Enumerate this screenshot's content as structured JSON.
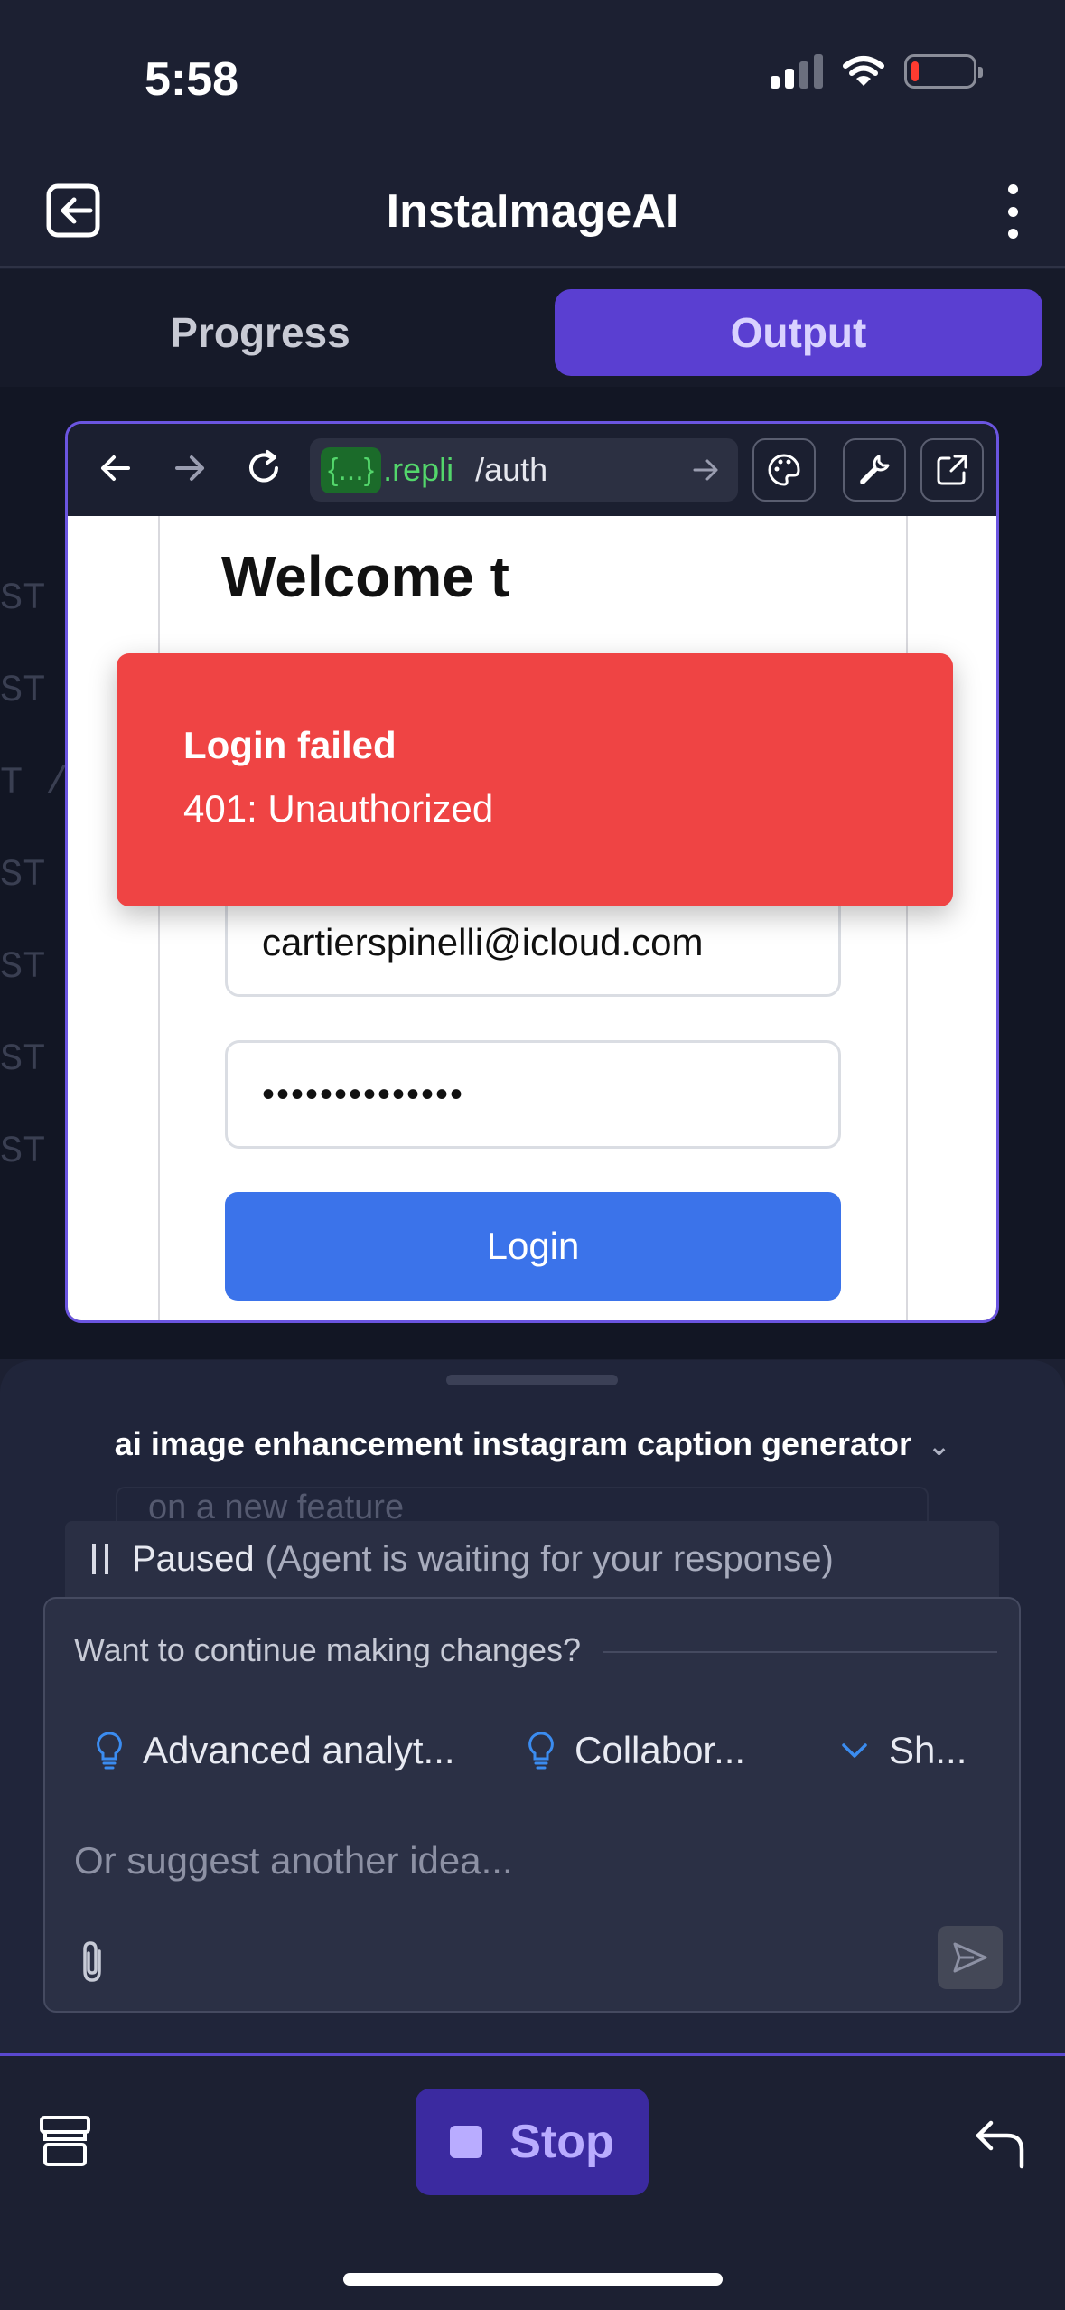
{
  "status_bar": {
    "time": "5:58",
    "battery_color": "#ff3b30"
  },
  "header": {
    "title": "InstaImageAI",
    "back_icon": "exit-icon",
    "menu_icon": "more-vertical-icon"
  },
  "tabs": [
    {
      "label": "Progress",
      "active": false
    },
    {
      "label": "Output",
      "active": true
    }
  ],
  "background_rows": [
    "ST",
    "ST",
    "T  /",
    "ST",
    "ST",
    "ST",
    "ST"
  ],
  "preview": {
    "url_badge": "{...}",
    "url_host": ".repli",
    "url_path": "/auth",
    "page": {
      "welcome_text": "Welcome t",
      "email_value": "cartierspinelli@icloud.com",
      "password_value": "••••••••••••••",
      "login_label": "Login"
    },
    "toast": {
      "title": "Login failed",
      "message": "401: Unauthorized",
      "color": "#ef4444"
    }
  },
  "sheet": {
    "project_name": "ai image enhancement instagram caption generator",
    "ghost_text": "on a new feature",
    "paused_label": "Paused",
    "paused_detail": "(Agent is waiting for your response)",
    "continue_question": "Want to continue making changes?",
    "chips": [
      {
        "label": "Advanced analyt...",
        "icon": "lightbulb-icon"
      },
      {
        "label": "Collabor...",
        "icon": "lightbulb-icon"
      },
      {
        "label": "Sh...",
        "icon": "chevron-down-icon"
      }
    ],
    "input_placeholder": "Or suggest another idea..."
  },
  "bottom_bar": {
    "stop_label": "Stop",
    "accent": "#5a48cf"
  }
}
